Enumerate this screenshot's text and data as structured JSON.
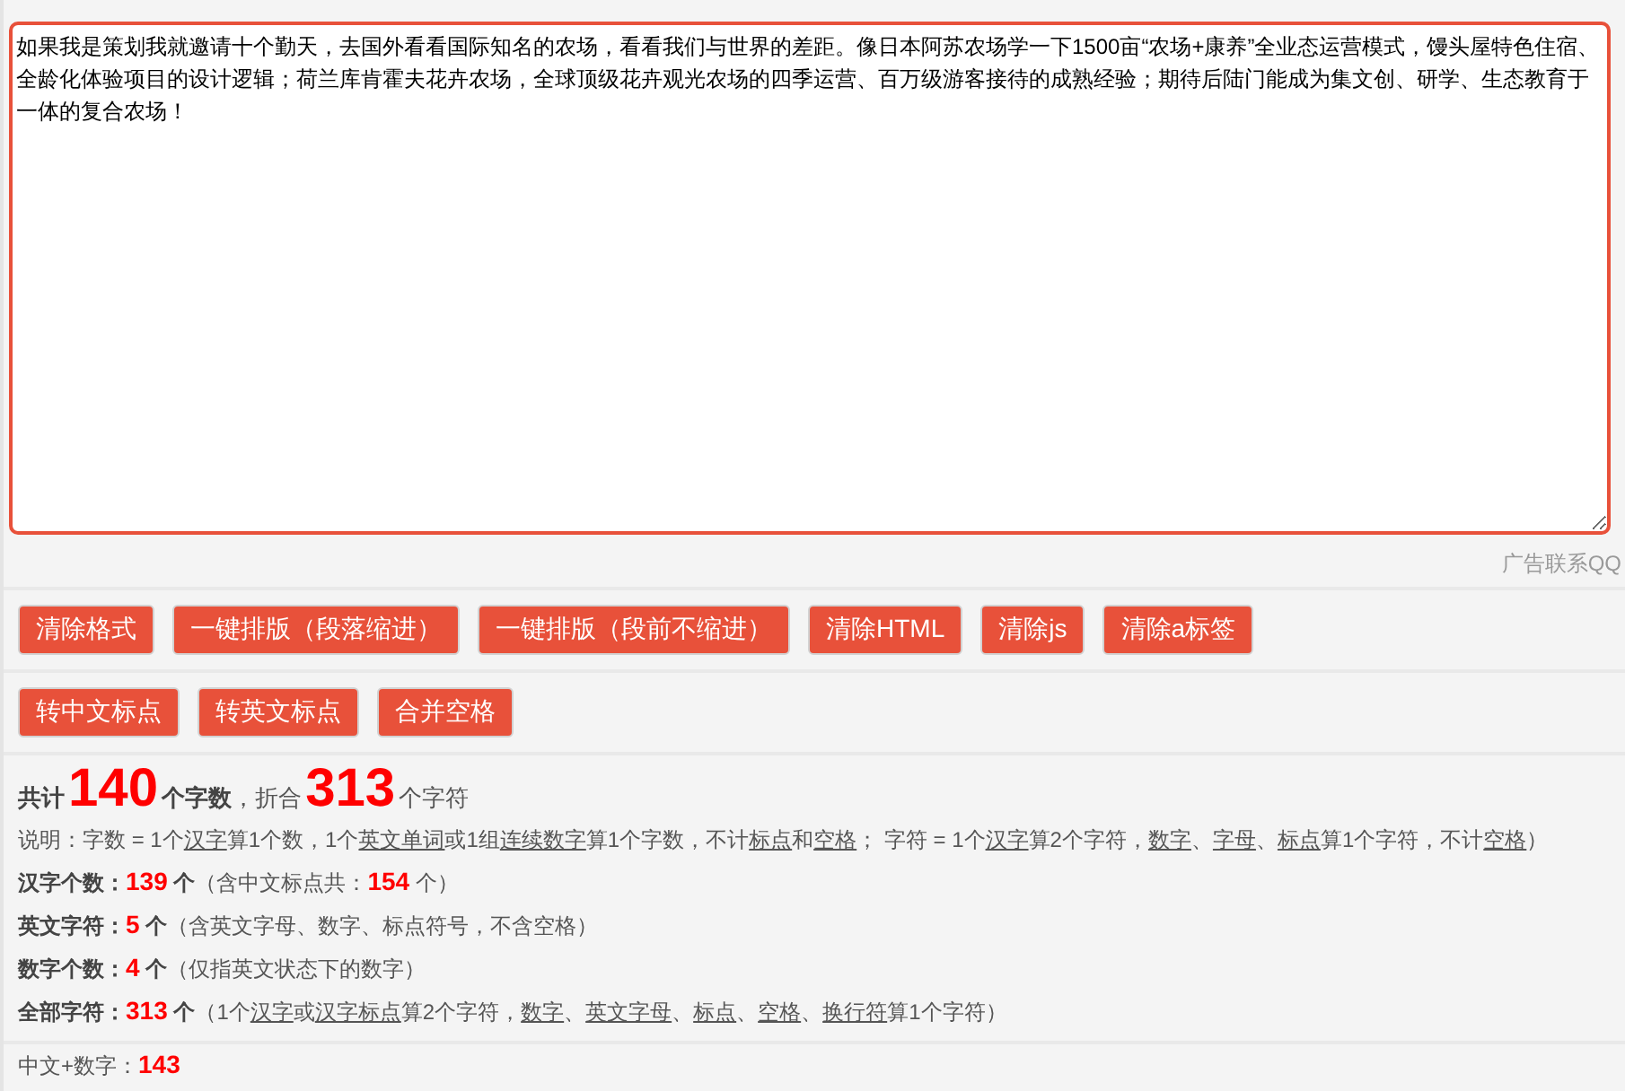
{
  "editor": {
    "value": "如果我是策划我就邀请十个勤天，去国外看看国际知名的农场，看看我们与世界的差距。像日本阿苏农场学一下1500亩“农场+康养”全业态运营模式，馒头屋特色住宿、全龄化体验项目的设计逻辑；荷兰库肯霍夫花卉农场，全球顶级花卉观光农场的四季运营、百万级游客接待的成熟经验；期待后陆门能成为集文创、研学、生态教育于一体的复合农场！"
  },
  "ad_link": "广告联系QQ",
  "button_rows": [
    [
      "清除格式",
      "一键排版（段落缩进）",
      "一键排版（段前不缩进）",
      "清除HTML",
      "清除js",
      "清除a标签"
    ],
    [
      "转中文标点",
      "转英文标点",
      "合并空格"
    ]
  ],
  "total": {
    "label": "共计",
    "words": "140",
    "words_unit": "个字数",
    "sep": "，折合",
    "chars": "313",
    "chars_unit": "个字符"
  },
  "explanation": [
    {
      "text": "说明：字数 = 1个",
      "underlined": false
    },
    {
      "text": "汉字",
      "underlined": true
    },
    {
      "text": "算1个数，1个",
      "underlined": false
    },
    {
      "text": "英文单词",
      "underlined": true
    },
    {
      "text": "或1组",
      "underlined": false
    },
    {
      "text": "连续数字",
      "underlined": true
    },
    {
      "text": "算1个字数，不计",
      "underlined": false
    },
    {
      "text": "标点",
      "underlined": true
    },
    {
      "text": "和",
      "underlined": false
    },
    {
      "text": "空格",
      "underlined": true
    },
    {
      "text": "；  字符 = 1个",
      "underlined": false
    },
    {
      "text": "汉字",
      "underlined": true
    },
    {
      "text": "算2个字符，",
      "underlined": false
    },
    {
      "text": "数字",
      "underlined": true
    },
    {
      "text": "、",
      "underlined": false
    },
    {
      "text": "字母",
      "underlined": true
    },
    {
      "text": "、",
      "underlined": false
    },
    {
      "text": "标点",
      "underlined": true
    },
    {
      "text": "算1个字符，不计",
      "underlined": false
    },
    {
      "text": "空格",
      "underlined": true
    },
    {
      "text": "）",
      "underlined": false
    }
  ],
  "stats": [
    [
      {
        "text": "汉字个数：",
        "kind": "label"
      },
      {
        "text": "139",
        "kind": "value"
      },
      {
        "text": " 个",
        "kind": "label"
      },
      {
        "text": "（含中文标点共：",
        "kind": "note"
      },
      {
        "text": "154",
        "kind": "value"
      },
      {
        "text": " 个）",
        "kind": "note"
      }
    ],
    [
      {
        "text": "英文字符：",
        "kind": "label"
      },
      {
        "text": "5",
        "kind": "value"
      },
      {
        "text": " 个",
        "kind": "label"
      },
      {
        "text": "（含英文字母、数字、标点符号，不含空格）",
        "kind": "note"
      }
    ],
    [
      {
        "text": "数字个数：",
        "kind": "label"
      },
      {
        "text": "4",
        "kind": "value"
      },
      {
        "text": " 个",
        "kind": "label"
      },
      {
        "text": "（仅指英文状态下的数字）",
        "kind": "note"
      }
    ],
    [
      {
        "text": "全部字符：",
        "kind": "label"
      },
      {
        "text": "313",
        "kind": "value"
      },
      {
        "text": " 个",
        "kind": "label"
      },
      {
        "text": "（1个",
        "kind": "note"
      },
      {
        "text": "汉字",
        "kind": "term"
      },
      {
        "text": "或",
        "kind": "note"
      },
      {
        "text": "汉字标点",
        "kind": "term"
      },
      {
        "text": "算2个字符，",
        "kind": "note"
      },
      {
        "text": "数字",
        "kind": "term"
      },
      {
        "text": "、",
        "kind": "note"
      },
      {
        "text": "英文字母",
        "kind": "term"
      },
      {
        "text": "、",
        "kind": "note"
      },
      {
        "text": "标点",
        "kind": "term"
      },
      {
        "text": "、",
        "kind": "note"
      },
      {
        "text": "空格",
        "kind": "term"
      },
      {
        "text": "、",
        "kind": "note"
      },
      {
        "text": "换行符",
        "kind": "term"
      },
      {
        "text": "算1个字符）",
        "kind": "note"
      }
    ]
  ],
  "footer": [
    {
      "text": "中文+数字：",
      "kind": "note"
    },
    {
      "text": "143",
      "kind": "value"
    }
  ]
}
